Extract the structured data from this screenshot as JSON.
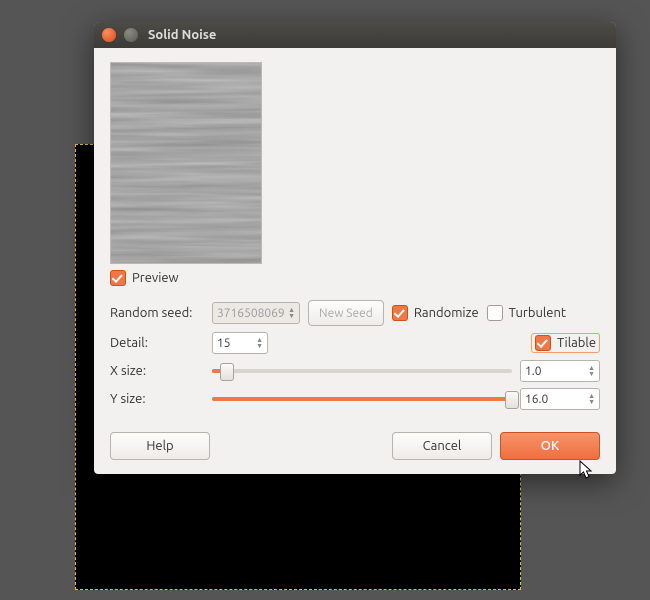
{
  "window": {
    "title": "Solid Noise"
  },
  "preview": {
    "label": "Preview",
    "checked": true
  },
  "seed": {
    "label": "Random seed:",
    "value": "3716508069",
    "new_seed": "New Seed",
    "randomize_label": "Randomize",
    "randomize_checked": true,
    "turbulent_label": "Turbulent",
    "turbulent_checked": false
  },
  "detail": {
    "label": "Detail:",
    "value": "15"
  },
  "tilable": {
    "label": "Tilable",
    "checked": true
  },
  "xsize": {
    "label": "X size:",
    "value": "1.0",
    "slider_percent": 5
  },
  "ysize": {
    "label": "Y size:",
    "value": "16.0",
    "slider_percent": 100
  },
  "buttons": {
    "help": "Help",
    "cancel": "Cancel",
    "ok": "OK"
  }
}
